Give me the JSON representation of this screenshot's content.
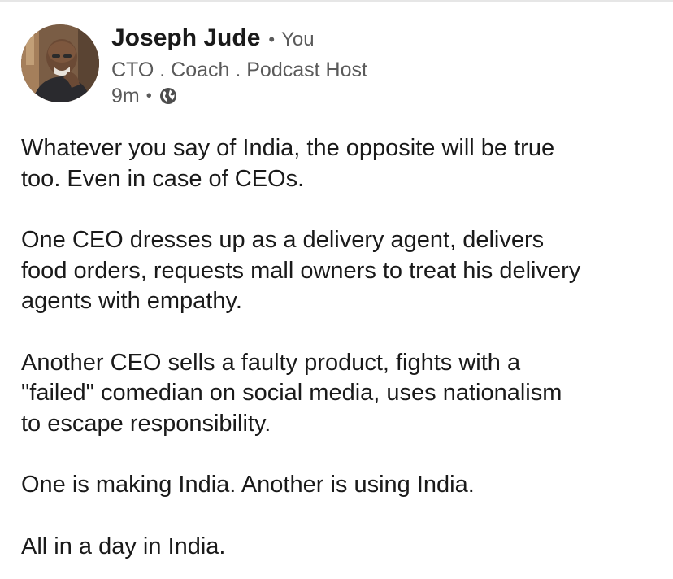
{
  "post": {
    "author": {
      "name": "Joseph Jude",
      "relation_separator": "•",
      "relation": "You",
      "headline": "CTO . Coach . Podcast Host",
      "time_ago": "9m",
      "meta_separator": "•",
      "visibility_icon": "globe-icon"
    },
    "body": {
      "paragraphs": [
        "Whatever you say of India, the opposite will be true\ntoo. Even in case of CEOs.",
        "One CEO dresses up as a delivery agent, delivers\nfood orders, requests mall owners to treat his delivery\nagents with empathy.",
        "Another CEO sells a faulty product, fights with a\n\"failed\" comedian on social media, uses nationalism\nto escape responsibility.",
        "One is making India. Another is using India.",
        "All in a day in India."
      ]
    }
  },
  "colors": {
    "text_primary": "#1a1a1a",
    "text_secondary": "#5a5a5a",
    "background": "#ffffff"
  }
}
